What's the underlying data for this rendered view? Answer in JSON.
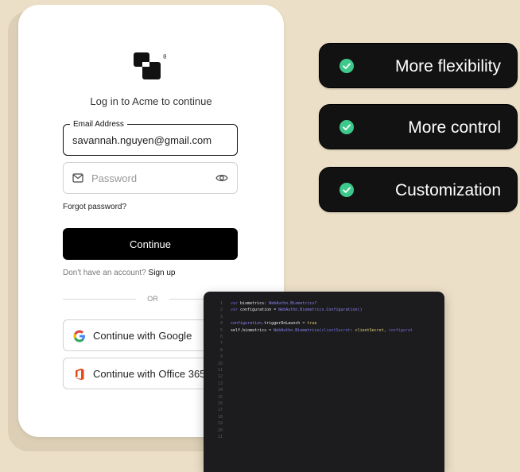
{
  "login": {
    "title": "Log in to Acme to continue",
    "email_label": "Email Address",
    "email_value": "savannah.nguyen@gmail.com",
    "password_placeholder": "Password",
    "forgot_password": "Forgot password?",
    "continue_label": "Continue",
    "signup_prompt": "Don't have an account?",
    "signup_link": "Sign up",
    "or_label": "OR",
    "google_label": "Continue with Google",
    "office_label": "Continue with Office 365",
    "logo_mark": "®"
  },
  "features": [
    {
      "label": "More flexibility",
      "icon": "check-circle-icon"
    },
    {
      "label": "More control",
      "icon": "check-circle-icon"
    },
    {
      "label": "Customization",
      "icon": "check-circle-icon"
    }
  ],
  "code": {
    "line_numbers": [
      "1",
      "2",
      "3",
      "4",
      "5",
      "6",
      "7",
      "8",
      "9",
      "10",
      "11",
      "12",
      "13",
      "14",
      "15",
      "16",
      "17",
      "18",
      "19",
      "20",
      "21"
    ],
    "lines": [
      [
        {
          "t": "var ",
          "c": "kw"
        },
        {
          "t": "biometrics",
          "c": "id"
        },
        {
          "t": ": ",
          "c": "pl"
        },
        {
          "t": "WebAuthn.Biometrics?",
          "c": "tp"
        }
      ],
      [
        {
          "t": "var ",
          "c": "kw"
        },
        {
          "t": "configuration",
          "c": "id"
        },
        {
          "t": " = ",
          "c": "pl"
        },
        {
          "t": "WebAuthn.Biometrics.Configuration()",
          "c": "tp"
        }
      ],
      [],
      [
        {
          "t": "configuration",
          "c": "tp"
        },
        {
          "t": ".triggerOnLaunch",
          "c": "id"
        },
        {
          "t": " = ",
          "c": "pl"
        },
        {
          "t": "true",
          "c": "val"
        }
      ],
      [
        {
          "t": "self",
          "c": "id"
        },
        {
          "t": ".biometrics",
          "c": "id"
        },
        {
          "t": " = ",
          "c": "pl"
        },
        {
          "t": "WebAuthn.Biometrics(",
          "c": "tp"
        },
        {
          "t": "clientSecret",
          "c": "pr"
        },
        {
          "t": ": ",
          "c": "pl"
        },
        {
          "t": "clientSecret",
          "c": "val"
        },
        {
          "t": ", ",
          "c": "pl"
        },
        {
          "t": "configurat",
          "c": "pr"
        }
      ]
    ]
  },
  "colors": {
    "background": "#ecdfc7",
    "pill_bg": "#121212",
    "check_green": "#3ec98c",
    "button_black": "#000000",
    "code_bg": "#1c1c1e",
    "office_orange": "#e64a19"
  }
}
